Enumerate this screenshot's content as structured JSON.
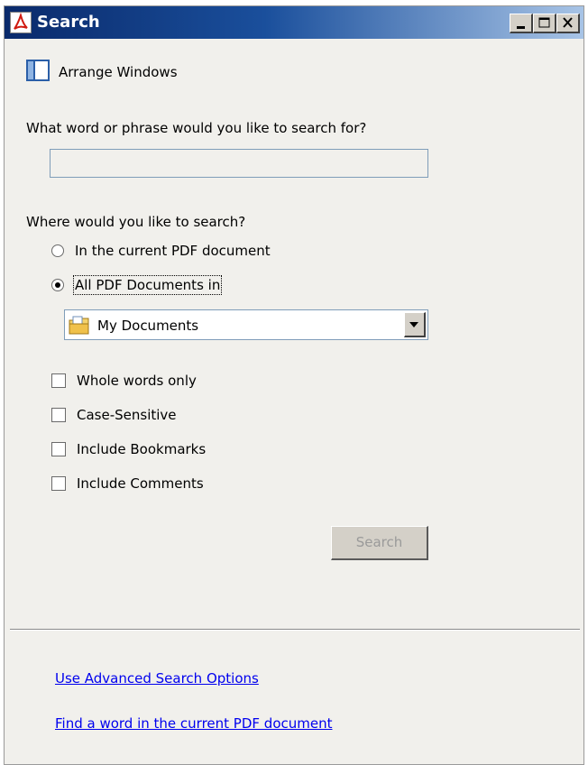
{
  "window": {
    "title": "Search",
    "controls": {
      "minimize": "minimize",
      "maximize": "maximize",
      "close": "close"
    }
  },
  "toolbar": {
    "arrange_label": "Arrange Windows"
  },
  "search": {
    "question": "What word or phrase would you like to search for?",
    "value": "",
    "placeholder": ""
  },
  "location": {
    "question": "Where would you like to search?",
    "options": [
      {
        "label": "In the current PDF document",
        "selected": false
      },
      {
        "label": "All PDF Documents in",
        "selected": true
      }
    ],
    "folder": "My Documents"
  },
  "options": [
    {
      "label": "Whole words only",
      "checked": false
    },
    {
      "label": "Case-Sensitive",
      "checked": false
    },
    {
      "label": "Include Bookmarks",
      "checked": false
    },
    {
      "label": "Include Comments",
      "checked": false
    }
  ],
  "actions": {
    "search_label": "Search",
    "search_enabled": false
  },
  "links": {
    "advanced": "Use Advanced Search Options",
    "find_word": "Find a word in the current PDF document"
  },
  "colors": {
    "titlebar_start": "#0a2a6b",
    "titlebar_end": "#a8c4e6",
    "panel_bg": "#f1f0ec",
    "link": "#0000ee"
  }
}
